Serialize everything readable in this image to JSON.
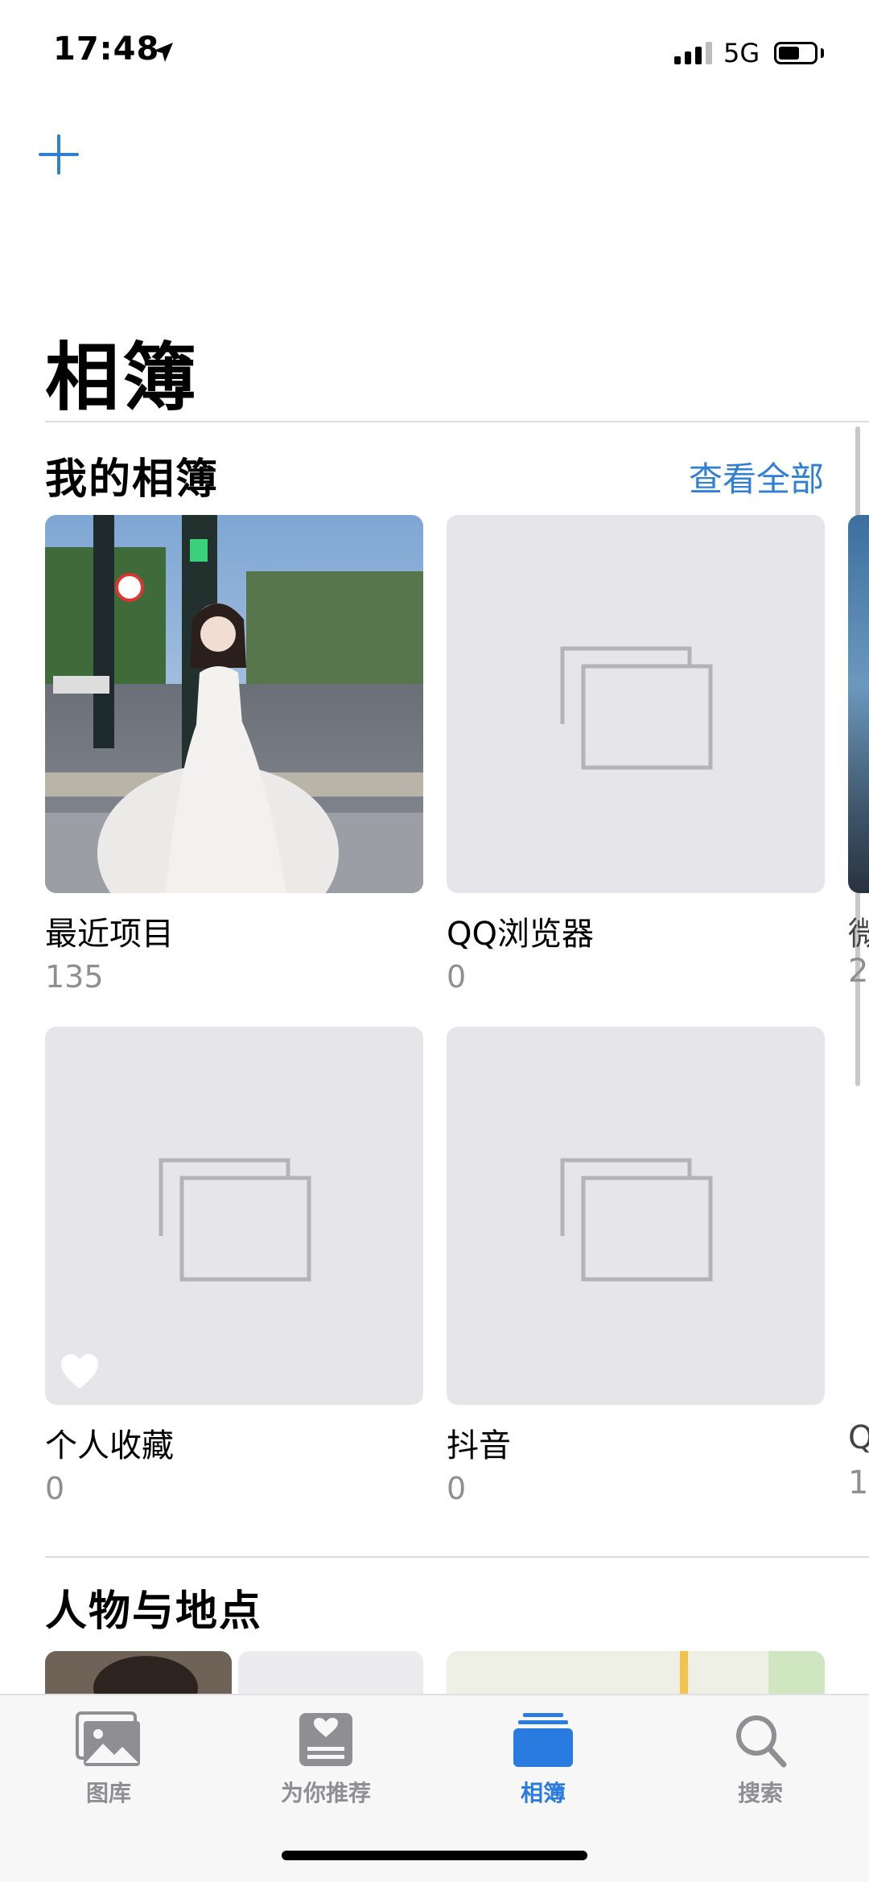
{
  "status_bar": {
    "time": "17:48",
    "network": "5G",
    "battery_level": 0.6
  },
  "header": {
    "title": "相簿"
  },
  "my_albums": {
    "title": "我的相簿",
    "see_all": "查看全部",
    "albums": [
      {
        "name": "最近项目",
        "count": "135"
      },
      {
        "name": "QQ浏览器",
        "count": "0"
      },
      {
        "name": "个人收藏",
        "count": "0"
      },
      {
        "name": "抖音",
        "count": "0"
      }
    ],
    "peek": [
      {
        "name": "微",
        "count": "2"
      },
      {
        "name": "Q",
        "count": "1"
      }
    ]
  },
  "people_places": {
    "title": "人物与地点"
  },
  "tabbar": {
    "tabs": [
      {
        "label": "图库",
        "icon": "photo-library-icon"
      },
      {
        "label": "为你推荐",
        "icon": "for-you-icon"
      },
      {
        "label": "相簿",
        "icon": "albums-icon",
        "active": true
      },
      {
        "label": "搜索",
        "icon": "search-icon"
      }
    ]
  },
  "colors": {
    "accent": "#2a7be0",
    "link": "#2f7fd4",
    "placeholder": "#e5e5ea",
    "secondary_text": "#8e8e93"
  }
}
